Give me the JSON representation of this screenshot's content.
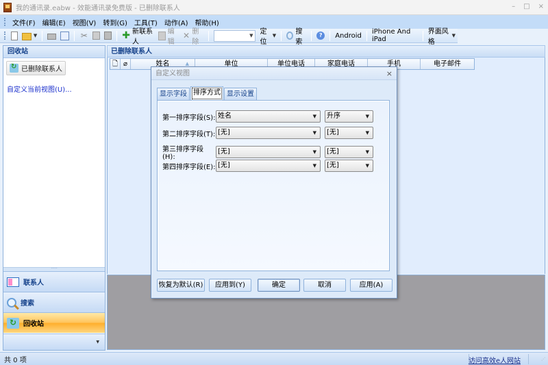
{
  "window": {
    "title": "我的通讯录.eabw - 效能通讯录免费版 - 已删除联系人",
    "controls": {
      "minimize": "–",
      "maximize": "□",
      "close": "×"
    }
  },
  "menubar": {
    "items": [
      {
        "label": "文件(F)"
      },
      {
        "label": "编辑(E)"
      },
      {
        "label": "视图(V)"
      },
      {
        "label": "转到(G)"
      },
      {
        "label": "工具(T)"
      },
      {
        "label": "动作(A)"
      },
      {
        "label": "帮助(H)"
      }
    ]
  },
  "toolbar": {
    "new_contact": "新联系人",
    "edit": "编辑",
    "delete": "删除",
    "locate_input": "",
    "locate": "定位",
    "search": "搜索",
    "help_icon": "?",
    "android": "Android",
    "iphone": "iPhone And iPad",
    "theme": "界面风格"
  },
  "sidebar": {
    "header": "回收站",
    "folder": "已删除联系人",
    "customize_link": "自定义当前视图(U)...",
    "nav": [
      {
        "label": "联系人",
        "icon": "contacts-icon",
        "active": false
      },
      {
        "label": "搜索",
        "icon": "search-icon",
        "active": false
      },
      {
        "label": "回收站",
        "icon": "recycle-bin-icon",
        "active": true
      }
    ]
  },
  "main": {
    "header": "已删除联系人",
    "columns": [
      "",
      "",
      "姓名",
      "单位",
      "单位电话",
      "家庭电话",
      "手机",
      "电子邮件"
    ],
    "sort_indicator": "▲"
  },
  "statusbar": {
    "count": "共 0 项",
    "link": "访问高效e人网站"
  },
  "dialog": {
    "title": "自定义视图",
    "close": "×",
    "tabs": [
      {
        "label": "显示字段",
        "active": false
      },
      {
        "label": "排序方式",
        "active": true
      },
      {
        "label": "显示设置",
        "active": false
      }
    ],
    "sort_rows": [
      {
        "label": "第一排序字段(S):",
        "field": "姓名",
        "order": "升序"
      },
      {
        "label": "第二排序字段(T):",
        "field": "[无]",
        "order": "[无]"
      },
      {
        "label": "第三排序字段(H):",
        "field": "[无]",
        "order": "[无]"
      },
      {
        "label": "第四排序字段(E):",
        "field": "[无]",
        "order": "[无]"
      }
    ],
    "buttons": {
      "restore_default": "恢复为默认(R)",
      "apply_to": "应用到(Y)",
      "ok": "确定",
      "cancel": "取消",
      "apply": "应用(A)"
    }
  }
}
